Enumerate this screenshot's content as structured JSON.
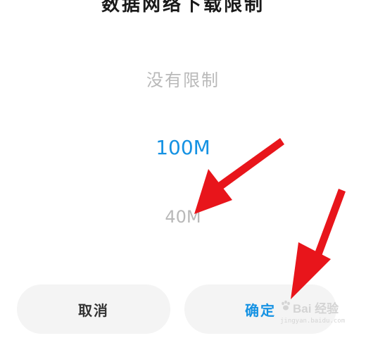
{
  "dialog": {
    "title": "数据网络下载限制",
    "options": {
      "above": "没有限制",
      "selected": "100M",
      "below": "40M"
    },
    "buttons": {
      "cancel": "取消",
      "confirm": "确定"
    }
  },
  "watermark": {
    "brand": "Bai 经验",
    "url": "jingyan.baidu.com"
  },
  "colors": {
    "accent": "#1592e3",
    "muted_option": "#b9b9b9",
    "button_bg": "#f4f4f4",
    "annotation_arrow": "#e8151b"
  },
  "icons": {
    "watermark_logo": "baidu-paw-icon"
  }
}
